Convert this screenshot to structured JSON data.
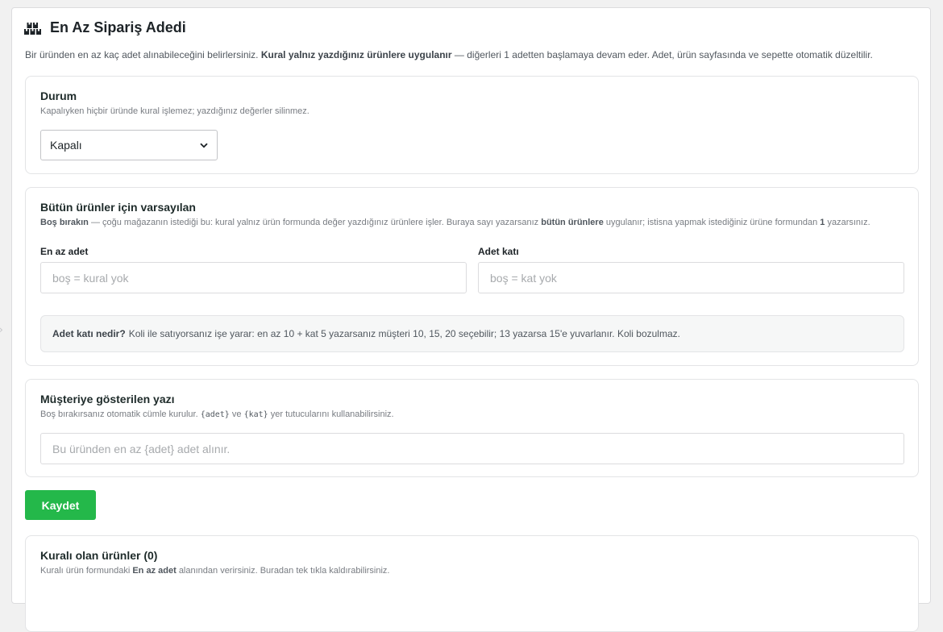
{
  "header": {
    "title": "En Az Sipariş Adedi",
    "icon": "boxes-icon",
    "intro_part1": "Bir üründen en az kaç adet alınabileceğini belirlersiniz.",
    "intro_bold": "Kural yalnız yazdığınız ürünlere uygulanır",
    "intro_part2": "— diğerleri 1 adetten başlamaya devam eder. Adet, ürün sayfasında ve sepette otomatik düzeltilir."
  },
  "status_card": {
    "title": "Durum",
    "subtitle": "Kapalıyken hiçbir üründe kural işlemez; yazdığınız değerler silinmez.",
    "select_value": "Kapalı"
  },
  "defaults_card": {
    "title": "Bütün ürünler için varsayılan",
    "sub_bold1": "Boş bırakın",
    "sub_part1": "— çoğu mağazanın istediği bu: kural yalnız ürün formunda değer yazdığınız ürünlere işler. Buraya sayı yazarsanız",
    "sub_bold2": "bütün ürünlere",
    "sub_part2": "uygulanır; istisna yapmak istediğiniz ürüne formundan",
    "sub_bold3": "1",
    "sub_part3": "yazarsınız.",
    "min_label": "En az adet",
    "min_placeholder": "boş = kural yok",
    "multiple_label": "Adet katı",
    "multiple_placeholder": "boş = kat yok",
    "info_bold": "Adet katı nedir?",
    "info_text": "Koli ile satıyorsanız işe yarar: en az 10 + kat 5 yazarsanız müşteri 10, 15, 20 seçebilir; 13 yazarsa 15'e yuvarlanır. Koli bozulmaz."
  },
  "message_card": {
    "title": "Müşteriye gösterilen yazı",
    "sub_part1": "Boş bırakırsanız otomatik cümle kurulur.",
    "code1": "{adet}",
    "sub_part2": "ve",
    "code2": "{kat}",
    "sub_part3": "yer tutucularını kullanabilirsiniz.",
    "placeholder": "Bu üründen en az {adet} adet alınır."
  },
  "save_label": "Kaydet",
  "rules_card": {
    "title": "Kuralı olan ürünler (0)",
    "sub_part1": "Kuralı ürün formundaki",
    "sub_bold": "En az adet",
    "sub_part2": "alanından verirsiniz. Buradan tek tıkla kaldırabilirsiniz."
  },
  "colors": {
    "accent_green": "#24b84a",
    "title_text": "#1e2b2a"
  }
}
